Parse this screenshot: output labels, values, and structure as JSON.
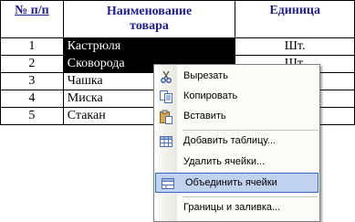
{
  "table": {
    "headers": {
      "num": "№ п/п",
      "name_line1": "Наименование",
      "name_line2": "товара",
      "unit": "Единица"
    },
    "rows": [
      {
        "num": "1",
        "name": "Кастрюля",
        "unit": "Шт."
      },
      {
        "num": "2",
        "name": "Сковорода",
        "unit": "Шт."
      },
      {
        "num": "3",
        "name": "Чашка",
        "unit": ""
      },
      {
        "num": "4",
        "name": "Миска",
        "unit": ""
      },
      {
        "num": "5",
        "name": "Стакан",
        "unit": ""
      }
    ]
  },
  "context_menu": {
    "items": [
      {
        "label": "Вырезать",
        "icon": "scissors-icon"
      },
      {
        "label": "Копировать",
        "icon": "copy-icon"
      },
      {
        "label": "Вставить",
        "icon": "paste-icon"
      },
      {
        "label": "Добавить таблицу...",
        "icon": "insert-table-icon"
      },
      {
        "label": "Удалить ячейки...",
        "icon": ""
      },
      {
        "label": "Объединить ячейки",
        "icon": "merge-cells-icon"
      },
      {
        "label": "Границы и заливка...",
        "icon": ""
      }
    ]
  },
  "colors": {
    "header_text": "#1f1f8f",
    "menu_highlight": "#c1d2ee",
    "menu_highlight_border": "#316ac5"
  }
}
